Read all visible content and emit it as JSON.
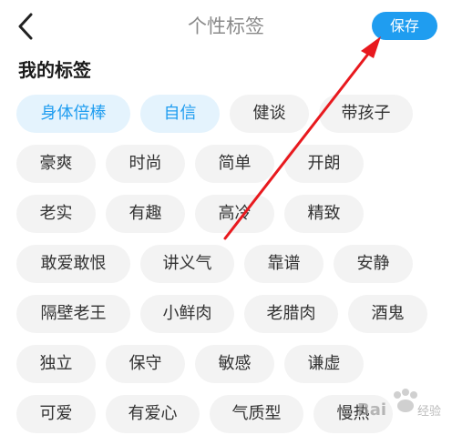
{
  "header": {
    "title": "个性标签",
    "save_label": "保存"
  },
  "section": {
    "title": "我的标签"
  },
  "tag_rows": [
    [
      {
        "label": "身体倍棒",
        "selected": true
      },
      {
        "label": "自信",
        "selected": true
      },
      {
        "label": "健谈",
        "selected": false
      },
      {
        "label": "带孩子",
        "selected": false
      }
    ],
    [
      {
        "label": "豪爽",
        "selected": false
      },
      {
        "label": "时尚",
        "selected": false
      },
      {
        "label": "简单",
        "selected": false
      },
      {
        "label": "开朗",
        "selected": false
      }
    ],
    [
      {
        "label": "老实",
        "selected": false
      },
      {
        "label": "有趣",
        "selected": false
      },
      {
        "label": "高冷",
        "selected": false
      },
      {
        "label": "精致",
        "selected": false
      }
    ],
    [
      {
        "label": "敢爱敢恨",
        "selected": false
      },
      {
        "label": "讲义气",
        "selected": false
      },
      {
        "label": "靠谱",
        "selected": false
      },
      {
        "label": "安静",
        "selected": false
      }
    ],
    [
      {
        "label": "隔壁老王",
        "selected": false
      },
      {
        "label": "小鲜肉",
        "selected": false
      },
      {
        "label": "老腊肉",
        "selected": false
      },
      {
        "label": "酒鬼",
        "selected": false
      }
    ],
    [
      {
        "label": "独立",
        "selected": false
      },
      {
        "label": "保守",
        "selected": false
      },
      {
        "label": "敏感",
        "selected": false
      },
      {
        "label": "谦虚",
        "selected": false
      }
    ],
    [
      {
        "label": "可爱",
        "selected": false
      },
      {
        "label": "有爱心",
        "selected": false
      },
      {
        "label": "气质型",
        "selected": false
      },
      {
        "label": "慢热",
        "selected": false
      }
    ]
  ],
  "colors": {
    "accent": "#1f9df0",
    "selected_bg": "#e4f3fd",
    "tag_bg": "#f3f3f3",
    "annotation_arrow": "#e8191e"
  },
  "icons": {
    "back": "chevron-left-icon"
  },
  "watermark": {
    "brand": "Bai",
    "brand_suffix": "经验"
  }
}
